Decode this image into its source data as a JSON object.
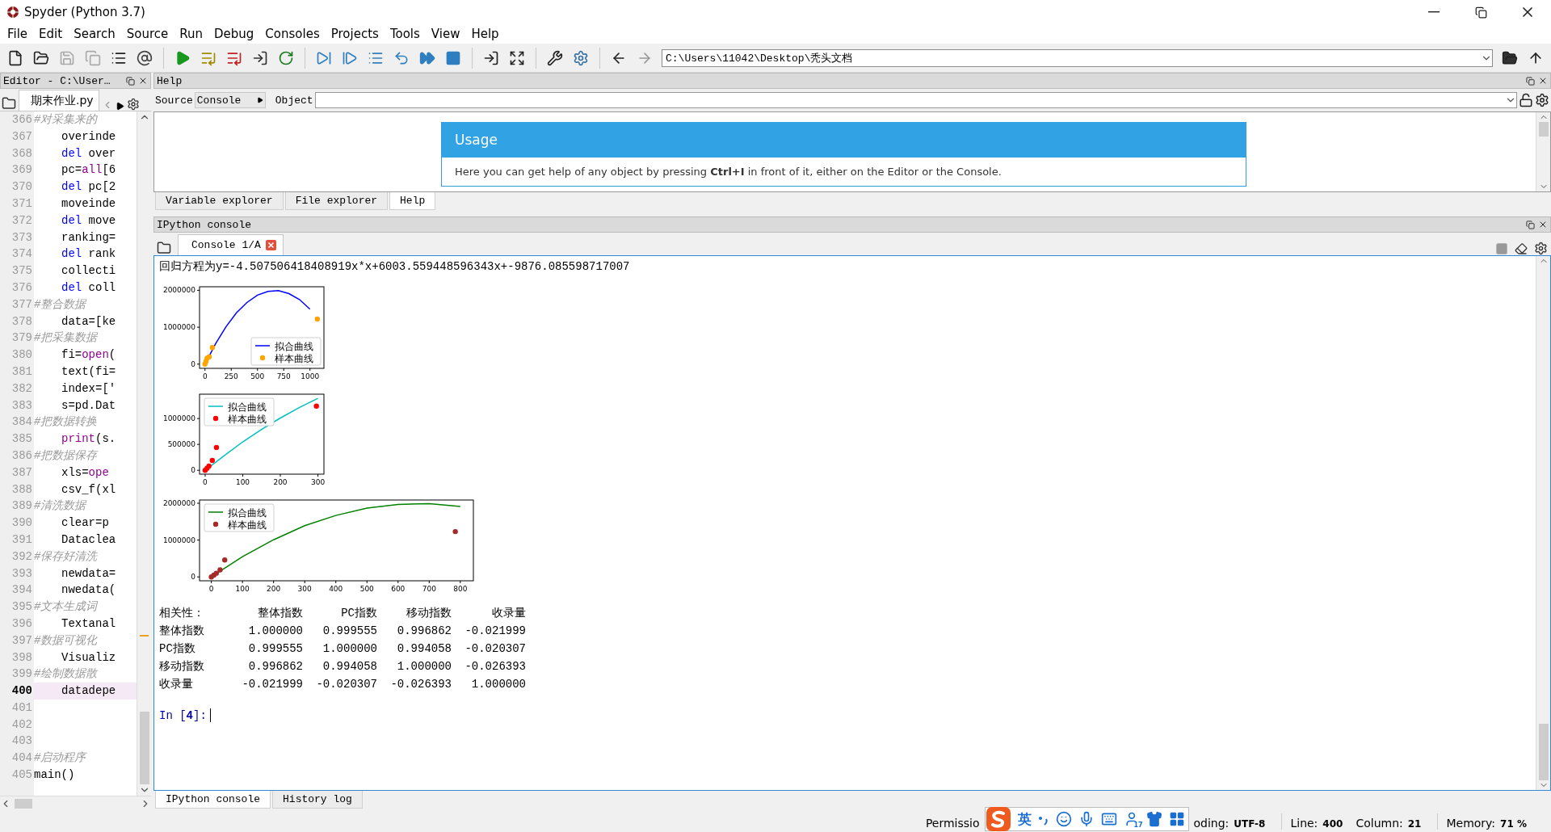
{
  "window": {
    "title": "Spyder (Python 3.7)"
  },
  "menu": [
    "File",
    "Edit",
    "Search",
    "Source",
    "Run",
    "Debug",
    "Consoles",
    "Projects",
    "Tools",
    "View",
    "Help"
  ],
  "toolbar": {
    "path": "C:\\Users\\11042\\Desktop\\秃头文档"
  },
  "editor": {
    "title": "Editor - C:\\User…",
    "file_tab": "期末作业.py",
    "lines": [
      {
        "number": "366",
        "current": false,
        "indented": false,
        "parts": [
          {
            "kind": "comment",
            "text": "#对采集来的"
          }
        ]
      },
      {
        "number": "367",
        "current": false,
        "indented": true,
        "parts": [
          {
            "kind": "code",
            "text": "overinde"
          }
        ]
      },
      {
        "number": "368",
        "current": false,
        "indented": true,
        "parts": [
          {
            "kind": "keyword",
            "text": "del"
          },
          {
            "kind": "code",
            "text": " over"
          }
        ]
      },
      {
        "number": "369",
        "current": false,
        "indented": true,
        "parts": [
          {
            "kind": "code",
            "text": "pc="
          },
          {
            "kind": "builtin",
            "text": "all"
          },
          {
            "kind": "code",
            "text": "[6"
          }
        ]
      },
      {
        "number": "370",
        "current": false,
        "indented": true,
        "parts": [
          {
            "kind": "keyword",
            "text": "del"
          },
          {
            "kind": "code",
            "text": " pc[2"
          }
        ]
      },
      {
        "number": "371",
        "current": false,
        "indented": true,
        "parts": [
          {
            "kind": "code",
            "text": "moveinde"
          }
        ]
      },
      {
        "number": "372",
        "current": false,
        "indented": true,
        "parts": [
          {
            "kind": "keyword",
            "text": "del"
          },
          {
            "kind": "code",
            "text": " move"
          }
        ]
      },
      {
        "number": "373",
        "current": false,
        "indented": true,
        "parts": [
          {
            "kind": "code",
            "text": "ranking="
          }
        ]
      },
      {
        "number": "374",
        "current": false,
        "indented": true,
        "parts": [
          {
            "kind": "keyword",
            "text": "del"
          },
          {
            "kind": "code",
            "text": " rank"
          }
        ]
      },
      {
        "number": "375",
        "current": false,
        "indented": true,
        "parts": [
          {
            "kind": "code",
            "text": "collecti"
          }
        ]
      },
      {
        "number": "376",
        "current": false,
        "indented": true,
        "parts": [
          {
            "kind": "keyword",
            "text": "del"
          },
          {
            "kind": "code",
            "text": " coll"
          }
        ]
      },
      {
        "number": "377",
        "current": false,
        "indented": false,
        "parts": [
          {
            "kind": "comment",
            "text": "#整合数据"
          }
        ]
      },
      {
        "number": "378",
        "current": false,
        "indented": true,
        "parts": [
          {
            "kind": "code",
            "text": "data=[ke"
          }
        ]
      },
      {
        "number": "379",
        "current": false,
        "indented": false,
        "parts": [
          {
            "kind": "comment",
            "text": "#把采集数据"
          }
        ]
      },
      {
        "number": "380",
        "current": false,
        "indented": true,
        "parts": [
          {
            "kind": "code",
            "text": "fi="
          },
          {
            "kind": "builtin",
            "text": "open"
          },
          {
            "kind": "code",
            "text": "("
          }
        ]
      },
      {
        "number": "381",
        "current": false,
        "indented": true,
        "parts": [
          {
            "kind": "code",
            "text": "text(fi="
          }
        ]
      },
      {
        "number": "382",
        "current": false,
        "indented": true,
        "parts": [
          {
            "kind": "code",
            "text": "index=['"
          }
        ]
      },
      {
        "number": "383",
        "current": false,
        "indented": true,
        "parts": [
          {
            "kind": "code",
            "text": "s=pd.Dat"
          }
        ]
      },
      {
        "number": "384",
        "current": false,
        "indented": false,
        "parts": [
          {
            "kind": "comment",
            "text": "#把数据转换"
          }
        ]
      },
      {
        "number": "385",
        "current": false,
        "indented": true,
        "parts": [
          {
            "kind": "builtin",
            "text": "print"
          },
          {
            "kind": "code",
            "text": "(s."
          }
        ]
      },
      {
        "number": "386",
        "current": false,
        "indented": false,
        "parts": [
          {
            "kind": "comment",
            "text": "#把数据保存"
          }
        ]
      },
      {
        "number": "387",
        "current": false,
        "indented": true,
        "parts": [
          {
            "kind": "code",
            "text": "xls="
          },
          {
            "kind": "builtin",
            "text": "ope"
          }
        ]
      },
      {
        "number": "388",
        "current": false,
        "indented": true,
        "parts": [
          {
            "kind": "code",
            "text": "csv_f(xl"
          }
        ]
      },
      {
        "number": "389",
        "current": false,
        "indented": false,
        "parts": [
          {
            "kind": "comment",
            "text": "#清洗数据"
          }
        ]
      },
      {
        "number": "390",
        "current": false,
        "indented": true,
        "parts": [
          {
            "kind": "code",
            "text": "clear=p"
          }
        ]
      },
      {
        "number": "391",
        "current": false,
        "indented": true,
        "parts": [
          {
            "kind": "code",
            "text": "Dataclea"
          }
        ]
      },
      {
        "number": "392",
        "current": false,
        "indented": false,
        "parts": [
          {
            "kind": "comment",
            "text": "#保存好清洗"
          }
        ]
      },
      {
        "number": "393",
        "current": false,
        "indented": true,
        "parts": [
          {
            "kind": "code",
            "text": "newdata="
          }
        ]
      },
      {
        "number": "394",
        "current": false,
        "indented": true,
        "parts": [
          {
            "kind": "code",
            "text": "nwedata("
          }
        ]
      },
      {
        "number": "395",
        "current": false,
        "indented": false,
        "parts": [
          {
            "kind": "comment",
            "text": "#文本生成词"
          }
        ]
      },
      {
        "number": "396",
        "current": false,
        "indented": true,
        "parts": [
          {
            "kind": "code",
            "text": "Textanal"
          }
        ]
      },
      {
        "number": "397",
        "current": false,
        "indented": false,
        "parts": [
          {
            "kind": "comment",
            "text": "#数据可视化"
          }
        ]
      },
      {
        "number": "398",
        "current": false,
        "indented": true,
        "parts": [
          {
            "kind": "code",
            "text": "Visualiz"
          }
        ]
      },
      {
        "number": "399",
        "current": false,
        "indented": false,
        "parts": [
          {
            "kind": "comment",
            "text": "#绘制数据散"
          }
        ]
      },
      {
        "number": "400",
        "current": true,
        "indented": true,
        "parts": [
          {
            "kind": "code",
            "text": "datadepe"
          }
        ]
      },
      {
        "number": "401",
        "current": false
      },
      {
        "number": "402",
        "current": false
      },
      {
        "number": "403",
        "current": false
      },
      {
        "number": "404",
        "current": false,
        "indented": false,
        "parts": [
          {
            "kind": "comment",
            "text": "#启动程序"
          }
        ]
      },
      {
        "number": "405",
        "current": false,
        "indented": false,
        "parts": [
          {
            "kind": "code",
            "text": "main()"
          }
        ]
      }
    ]
  },
  "help": {
    "title": "Help",
    "source_label": "Source",
    "source": "Console",
    "object_label": "Object",
    "usage_title": "Usage",
    "usage_text": "Here you can get help of any object by pressing **Ctrl+I** in front of it, either on the Editor or the Console.",
    "tabs": [
      {
        "label": "Variable explorer",
        "selected": false
      },
      {
        "label": "File explorer",
        "selected": false
      },
      {
        "label": "Help",
        "selected": true
      }
    ]
  },
  "console": {
    "title": "IPython console",
    "tab": "Console 1/A",
    "output": "回归方程为y=-4.507506418408919x*x+6003.559448596343x+-9876.085598717007",
    "charts": [
      {
        "chart_data": {
          "type": "line",
          "legend": "lower right",
          "xlim": [
            -52,
            1133
          ],
          "ylim": [
            -114000,
            2096000
          ],
          "xticks": [
            0,
            250,
            500,
            750,
            1000
          ],
          "yticks": [
            0,
            1000000,
            2000000
          ],
          "series": [
            {
              "name": "拟合曲线",
              "color": "#0000ff",
              "type": "line",
              "x": [
                0,
                100,
                200,
                300,
                400,
                500,
                600,
                700,
                800,
                900,
                1000
              ],
              "values": [
                0,
                550000,
                1010000,
                1390000,
                1670000,
                1870000,
                1970000,
                1990000,
                1910000,
                1750000,
                1490000
              ]
            },
            {
              "name": "样本曲线",
              "color": "#ffa500",
              "type": "scatter",
              "x": [
                0,
                10,
                20,
                40,
                70,
                1070
              ],
              "values": [
                0,
                80000,
                160000,
                200000,
                450000,
                1220000
              ]
            }
          ]
        }
      },
      {
        "chart_data": {
          "type": "line",
          "legend": "upper left",
          "xlim": [
            -15,
            316
          ],
          "ylim": [
            -75000,
            1470000
          ],
          "xticks": [
            0,
            100,
            200,
            300
          ],
          "yticks": [
            0,
            500000,
            1000000
          ],
          "series": [
            {
              "name": "拟合曲线",
              "color": "#00bfbf",
              "type": "line",
              "x": [
                0,
                50,
                100,
                150,
                200,
                250,
                300
              ],
              "values": [
                0,
                280000,
                550000,
                790000,
                1010000,
                1210000,
                1390000
              ]
            },
            {
              "name": "样本曲线",
              "color": "#ff0000",
              "type": "scatter",
              "x": [
                0,
                5,
                10,
                19,
                30,
                296
              ],
              "values": [
                0,
                40000,
                80000,
                190000,
                440000,
                1240000
              ]
            }
          ]
        }
      },
      {
        "chart_data": {
          "type": "line",
          "legend": "upper left",
          "xlim": [
            -38,
            842
          ],
          "ylim": [
            -105000,
            2088000
          ],
          "xticks": [
            0,
            100,
            200,
            300,
            400,
            500,
            600,
            700,
            800
          ],
          "yticks": [
            0,
            1000000,
            2000000
          ],
          "series": [
            {
              "name": "拟合曲线",
              "color": "#008000",
              "type": "line",
              "x": [
                0,
                100,
                200,
                300,
                400,
                500,
                600,
                700,
                800
              ],
              "values": [
                0,
                550000,
                1010000,
                1390000,
                1670000,
                1870000,
                1970000,
                1990000,
                1910000
              ]
            },
            {
              "name": "样本曲线",
              "color": "#a52a2a",
              "type": "scatter",
              "x": [
                0,
                8,
                16,
                28,
                43,
                784
              ],
              "values": [
                0,
                50000,
                100000,
                190000,
                460000,
                1230000
              ]
            }
          ]
        }
      }
    ],
    "correlation": {
      "columns": [
        "相关性：",
        "整体指数",
        "PC指数",
        "移动指数",
        "收录量"
      ],
      "rows": [
        [
          "整体指数",
          "1.000000",
          "0.999555",
          "0.996862",
          "-0.021999"
        ],
        [
          "PC指数",
          "0.999555",
          "1.000000",
          "0.994058",
          "-0.020307"
        ],
        [
          "移动指数",
          "0.996862",
          "0.994058",
          "1.000000",
          "-0.026393"
        ],
        [
          "收录量",
          "-0.021999",
          "-0.020307",
          "-0.026393",
          "1.000000"
        ]
      ]
    },
    "prompt": "In [**4**]:"
  },
  "bottom_tabs": [
    {
      "label": "IPython console",
      "selected": true
    },
    {
      "label": "History log",
      "selected": false
    }
  ],
  "ime": {
    "language": "英",
    "badge": "17"
  },
  "status_bar": {
    "permissions": "Permissio",
    "encoding_label": "oding:",
    "encoding": "UTF-8",
    "line_label": "Line:",
    "line": "400",
    "column_label": "Column:",
    "column": "21",
    "memory_label": "Memory:",
    "memory": "71 %"
  }
}
